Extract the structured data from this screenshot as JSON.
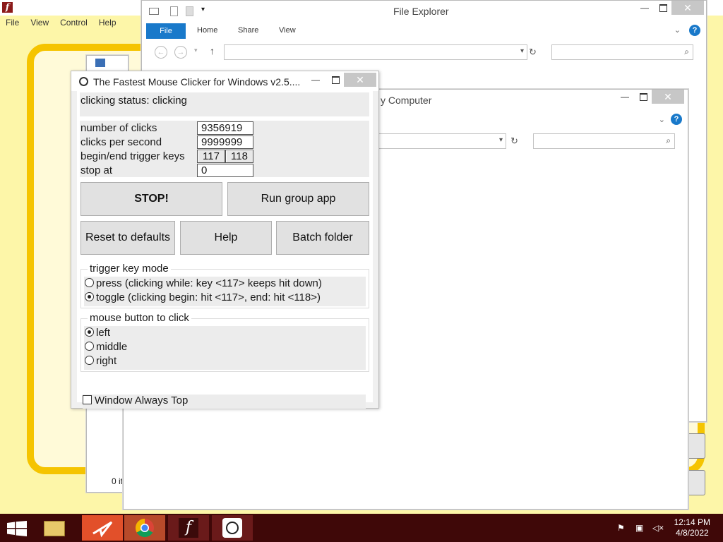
{
  "flash_app": {
    "menu": [
      "File",
      "View",
      "Control",
      "Help"
    ]
  },
  "explorer_front": {
    "title": "File Explorer",
    "ribbon_tabs": [
      "File",
      "Home",
      "Share",
      "View"
    ],
    "address_value": "",
    "search_value": ""
  },
  "explorer_back": {
    "title": "y Computer",
    "status_text": "0 it",
    "address_value": "",
    "search_value": ""
  },
  "clicker": {
    "title": "The Fastest Mouse Clicker for Windows v2.5....",
    "status_text": "clicking status: clicking",
    "num_clicks_label": "number of clicks",
    "num_clicks_value": "9356919",
    "cps_label": "clicks per second",
    "cps_value": "9999999",
    "trigger_keys_label": "begin/end trigger keys",
    "trigger_begin": "117",
    "trigger_end": "118",
    "stop_at_label": "stop at",
    "stop_at_value": "0",
    "buttons": {
      "stop": "STOP!",
      "run_group": "Run group app",
      "reset": "Reset to defaults",
      "help": "Help",
      "batch": "Batch folder"
    },
    "trigger_mode": {
      "title": "trigger key mode",
      "options": [
        {
          "label": "press (clicking while: key <117> keeps hit down)",
          "selected": false
        },
        {
          "label": "toggle (clicking begin: hit <117>, end: hit <118>)",
          "selected": true
        }
      ]
    },
    "mouse_button": {
      "title": "mouse button to click",
      "options": [
        {
          "label": "left",
          "selected": true
        },
        {
          "label": "middle",
          "selected": false
        },
        {
          "label": "right",
          "selected": false
        }
      ]
    },
    "always_top_label": "Window Always Top",
    "always_top_checked": false
  },
  "taskbar": {
    "time": "12:14 PM",
    "date": "4/8/2022"
  }
}
